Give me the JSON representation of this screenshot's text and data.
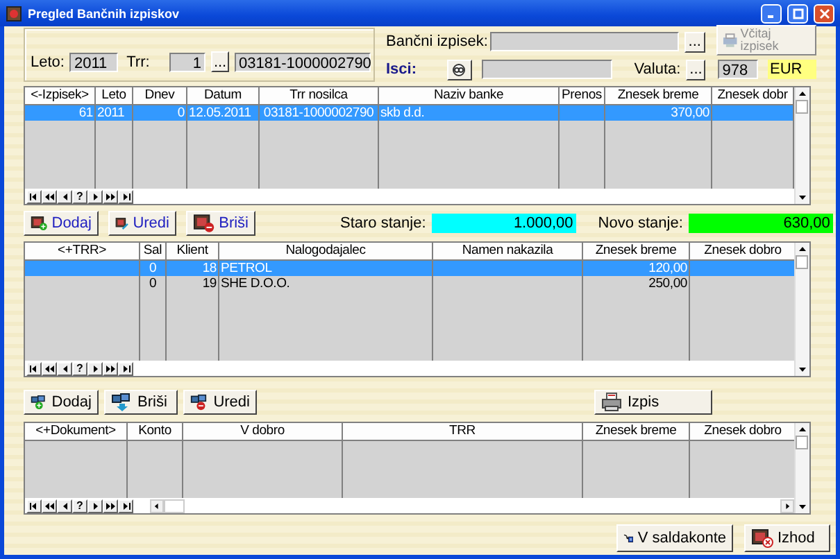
{
  "window": {
    "title": "Pregled Bančnih izpiskov"
  },
  "header": {
    "year_label": "Leto:",
    "year": "2011",
    "trr_label": "Trr:",
    "trr_number": "1",
    "trr_browse": "...",
    "account": "03181-1000002790",
    "statement_label": "Bančni izpisek:",
    "statement_browse": "...",
    "load_button": {
      "label": "Včitaj izpisek",
      "disabled": true
    },
    "search_label": "Isci:",
    "currency_label": "Valuta:",
    "currency_browse": "...",
    "currency_code": "978",
    "currency": "EUR"
  },
  "statements": {
    "columns": [
      "<-Izpisek>",
      "Leto",
      "Dnev",
      "Datum",
      "Trr nosilca",
      "Naziv banke",
      "Prenos",
      "Znesek breme",
      "Znesek dobr"
    ],
    "rows": [
      {
        "cells": [
          "61",
          "2011",
          "0",
          "12.05.2011",
          "03181-1000002790",
          "skb d.d.",
          null,
          "370,00",
          null
        ],
        "selected": true
      }
    ],
    "navigator": [
      {
        "kind": "first"
      },
      {
        "kind": "prev_page"
      },
      {
        "kind": "prev"
      },
      {
        "kind": "find",
        "label": "?"
      },
      {
        "kind": "next"
      },
      {
        "kind": "next_page"
      },
      {
        "kind": "last"
      }
    ]
  },
  "statement_buttons": [
    {
      "kind": "add",
      "label": "Dodaj"
    },
    {
      "kind": "edit",
      "label": "Uredi"
    },
    {
      "kind": "delete",
      "label": "Briši"
    }
  ],
  "balances": [
    {
      "label": "Staro stanje:",
      "value": "1.000,00",
      "color": "#00ffff"
    },
    {
      "label": "Novo stanje:",
      "value": "630,00",
      "color": "#00ff00"
    }
  ],
  "transfers": {
    "columns": [
      "<+TRR>",
      "Sal",
      "Klient",
      "Nalogodajalec",
      "Namen nakazila",
      "Znesek breme",
      "Znesek dobro"
    ],
    "rows": [
      {
        "cells": [
          null,
          "0",
          "18",
          "PETROL",
          null,
          "120,00",
          null
        ],
        "selected": true
      },
      {
        "cells": [
          null,
          "0",
          "19",
          "SHE D.O.O.",
          null,
          "250,00",
          null
        ],
        "selected": false
      }
    ],
    "navigator": [
      {
        "kind": "first"
      },
      {
        "kind": "prev_page"
      },
      {
        "kind": "prev"
      },
      {
        "kind": "find",
        "label": "?"
      },
      {
        "kind": "next"
      },
      {
        "kind": "next_page"
      },
      {
        "kind": "last"
      }
    ]
  },
  "transfer_buttons": [
    {
      "kind": "link_add",
      "label": "Dodaj"
    },
    {
      "kind": "link_remove",
      "label": "Briši"
    },
    {
      "kind": "link_edit",
      "label": "Uredi"
    }
  ],
  "print_button": {
    "kind": "print",
    "label": "Izpis"
  },
  "documents": {
    "columns": [
      "<+Dokument>",
      "Konto",
      "V dobro",
      "TRR",
      "Znesek breme",
      "Znesek dobro"
    ],
    "navigator": [
      {
        "kind": "first"
      },
      {
        "kind": "prev_page"
      },
      {
        "kind": "prev"
      },
      {
        "kind": "find",
        "label": "?"
      },
      {
        "kind": "next"
      },
      {
        "kind": "next_page"
      },
      {
        "kind": "last"
      }
    ]
  },
  "footer_buttons": [
    {
      "kind": "transfer",
      "label": "V saldakonte"
    },
    {
      "kind": "exit",
      "label": "Izhod"
    }
  ]
}
